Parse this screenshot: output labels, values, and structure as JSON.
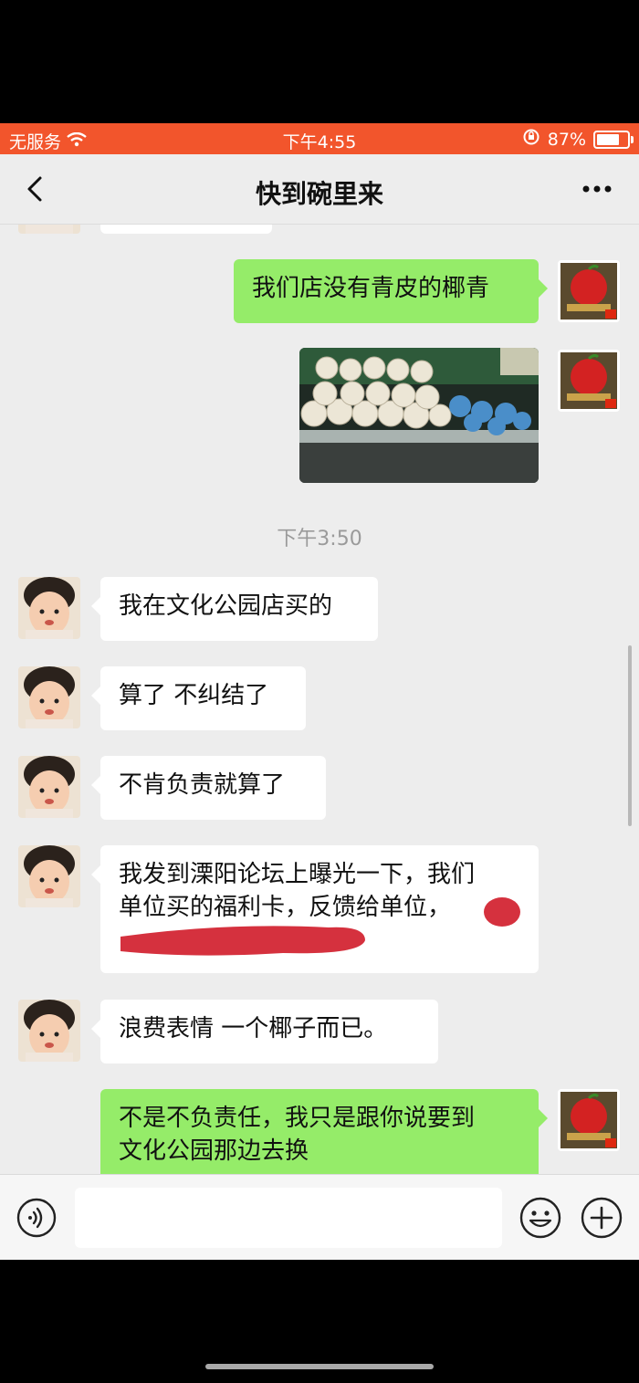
{
  "status_bar": {
    "carrier": "无服务",
    "time": "下午4:55",
    "battery": "87%",
    "battery_level": 0.87,
    "icons": [
      "wifi-icon",
      "orientation-lock-icon",
      "battery-icon"
    ],
    "background": "#f2552c"
  },
  "nav": {
    "title": "快到碗里来",
    "back_icon": "chevron-left-icon",
    "more_icon": "more-dots-icon"
  },
  "messages": [
    {
      "side": "right",
      "type": "text",
      "text": "我们店没有青皮的椰青"
    },
    {
      "side": "right",
      "type": "image",
      "alt": "coconuts-on-shelf"
    },
    {
      "type": "timestamp",
      "text": "下午3:50"
    },
    {
      "side": "left",
      "type": "text",
      "text": "我在文化公园店买的"
    },
    {
      "side": "left",
      "type": "text",
      "text": "算了 不纠结了"
    },
    {
      "side": "left",
      "type": "text",
      "text": "不肯负责就算了"
    },
    {
      "side": "left",
      "type": "text",
      "line1": "我发到溧阳论坛上曝光一下，我们",
      "line2": "单位买的福利卡，反馈给单位，"
    },
    {
      "side": "left",
      "type": "text",
      "text": "浪费表情 一个椰子而已。"
    },
    {
      "side": "right",
      "type": "text",
      "line1": "不是不负责任，我只是跟你说要到",
      "line2": "文化公园那边去换"
    }
  ],
  "input_bar": {
    "placeholder": "",
    "voice_icon": "voice-icon",
    "emoji_icon": "emoji-icon",
    "plus_icon": "plus-icon"
  },
  "colors": {
    "accent": "#f2552c",
    "bubble_green": "#95ec69",
    "bubble_white": "#ffffff",
    "chat_bg": "#ededed",
    "redaction": "#d11f2e"
  }
}
